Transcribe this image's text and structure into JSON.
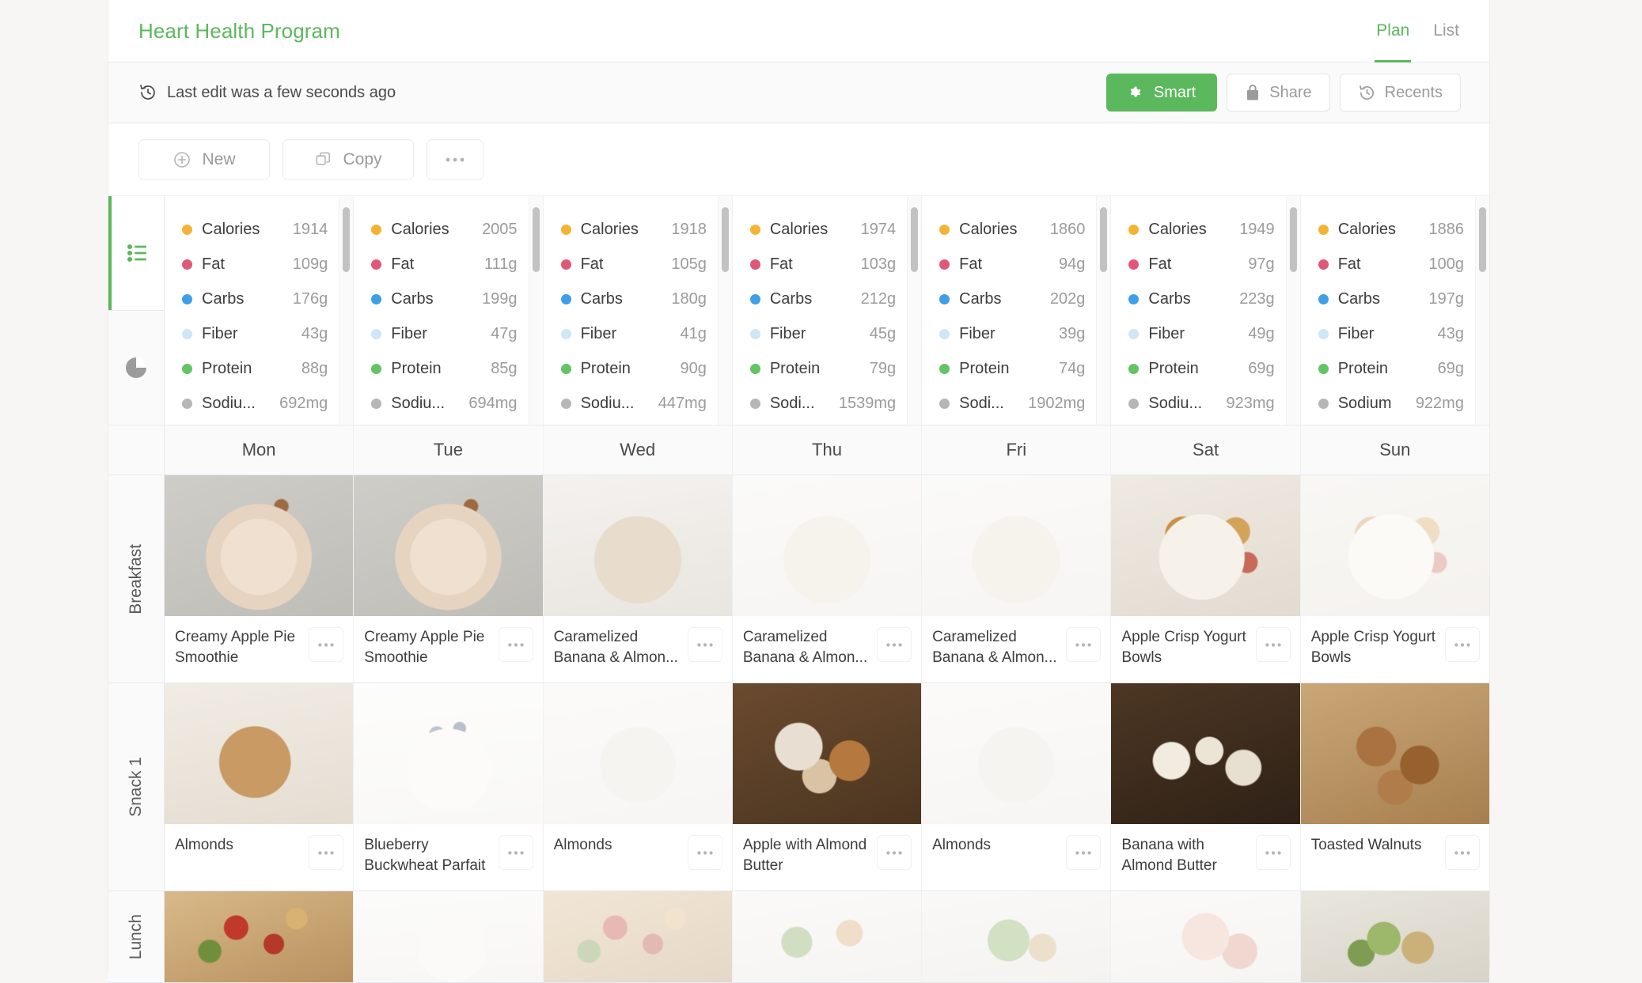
{
  "header": {
    "title": "Heart Health Program",
    "tabs": [
      {
        "label": "Plan",
        "active": true
      },
      {
        "label": "List",
        "active": false
      }
    ]
  },
  "subheader": {
    "last_edit": "Last edit was a few seconds ago",
    "last_edit_icon": "history-icon",
    "buttons": [
      {
        "label": "Smart",
        "icon": "gear-icon",
        "style": "primary",
        "color": "#5cb85c"
      },
      {
        "label": "Share",
        "icon": "lock-icon",
        "style": "default"
      },
      {
        "label": "Recents",
        "icon": "history-icon",
        "style": "default"
      }
    ]
  },
  "toolbar": {
    "buttons": [
      {
        "label": "New",
        "icon": "plus-circle-icon"
      },
      {
        "label": "Copy",
        "icon": "copy-icon"
      },
      {
        "label": "",
        "icon": "ellipsis-icon"
      }
    ]
  },
  "rail": {
    "items": [
      {
        "name": "list-view",
        "icon": "list-icon",
        "active": true,
        "color": "#5cb85c"
      },
      {
        "name": "chart-view",
        "icon": "pie-chart-icon",
        "active": false,
        "color": "#9b9b9b"
      }
    ]
  },
  "nutrition": {
    "labels": [
      "Calories",
      "Fat",
      "Carbs",
      "Fiber",
      "Protein",
      "Sodium"
    ],
    "colors": {
      "Calories": "#f5b335",
      "Fat": "#e05878",
      "Carbs": "#3d9fe8",
      "Fiber": "#cfe6f7",
      "Protein": "#63c463",
      "Sodium": "#b6b6b6"
    },
    "columns": [
      {
        "day": "Mon",
        "sodium_label": "Sodiu...",
        "rows": [
          {
            "label": "Calories",
            "value": "1914"
          },
          {
            "label": "Fat",
            "value": "109g"
          },
          {
            "label": "Carbs",
            "value": "176g"
          },
          {
            "label": "Fiber",
            "value": "43g"
          },
          {
            "label": "Protein",
            "value": "88g"
          },
          {
            "label": "Sodiu...",
            "value": "692mg"
          }
        ]
      },
      {
        "day": "Tue",
        "sodium_label": "Sodiu...",
        "rows": [
          {
            "label": "Calories",
            "value": "2005"
          },
          {
            "label": "Fat",
            "value": "111g"
          },
          {
            "label": "Carbs",
            "value": "199g"
          },
          {
            "label": "Fiber",
            "value": "47g"
          },
          {
            "label": "Protein",
            "value": "85g"
          },
          {
            "label": "Sodiu...",
            "value": "694mg"
          }
        ]
      },
      {
        "day": "Wed",
        "sodium_label": "Sodiu...",
        "rows": [
          {
            "label": "Calories",
            "value": "1918"
          },
          {
            "label": "Fat",
            "value": "105g"
          },
          {
            "label": "Carbs",
            "value": "180g"
          },
          {
            "label": "Fiber",
            "value": "41g"
          },
          {
            "label": "Protein",
            "value": "90g"
          },
          {
            "label": "Sodiu...",
            "value": "447mg"
          }
        ]
      },
      {
        "day": "Thu",
        "sodium_label": "Sodi...",
        "rows": [
          {
            "label": "Calories",
            "value": "1974"
          },
          {
            "label": "Fat",
            "value": "103g"
          },
          {
            "label": "Carbs",
            "value": "212g"
          },
          {
            "label": "Fiber",
            "value": "45g"
          },
          {
            "label": "Protein",
            "value": "79g"
          },
          {
            "label": "Sodi...",
            "value": "1539mg"
          }
        ]
      },
      {
        "day": "Fri",
        "sodium_label": "Sodi...",
        "rows": [
          {
            "label": "Calories",
            "value": "1860"
          },
          {
            "label": "Fat",
            "value": "94g"
          },
          {
            "label": "Carbs",
            "value": "202g"
          },
          {
            "label": "Fiber",
            "value": "39g"
          },
          {
            "label": "Protein",
            "value": "74g"
          },
          {
            "label": "Sodi...",
            "value": "1902mg"
          }
        ]
      },
      {
        "day": "Sat",
        "sodium_label": "Sodiu...",
        "rows": [
          {
            "label": "Calories",
            "value": "1949"
          },
          {
            "label": "Fat",
            "value": "97g"
          },
          {
            "label": "Carbs",
            "value": "223g"
          },
          {
            "label": "Fiber",
            "value": "49g"
          },
          {
            "label": "Protein",
            "value": "69g"
          },
          {
            "label": "Sodiu...",
            "value": "923mg"
          }
        ]
      },
      {
        "day": "Sun",
        "sodium_label": "Sodium",
        "rows": [
          {
            "label": "Calories",
            "value": "1886"
          },
          {
            "label": "Fat",
            "value": "100g"
          },
          {
            "label": "Carbs",
            "value": "197g"
          },
          {
            "label": "Fiber",
            "value": "43g"
          },
          {
            "label": "Protein",
            "value": "69g"
          },
          {
            "label": "Sodium",
            "value": "922mg"
          }
        ]
      }
    ]
  },
  "days": [
    "Mon",
    "Tue",
    "Wed",
    "Thu",
    "Fri",
    "Sat",
    "Sun"
  ],
  "meals": [
    {
      "label": "Breakfast",
      "cells": [
        {
          "title": "Creamy Apple Pie Smoothie",
          "image": "smoothie-cinnamon",
          "faded": false
        },
        {
          "title": "Creamy Apple Pie Smoothie",
          "image": "smoothie-cinnamon",
          "faded": false
        },
        {
          "title": "Caramelized Banana & Almon...",
          "image": "oat-bowl-nutbutter",
          "faded": false
        },
        {
          "title": "Caramelized Banana & Almon...",
          "image": "oat-bowl-nutbutter",
          "faded": true
        },
        {
          "title": "Caramelized Banana & Almon...",
          "image": "oat-bowl-nutbutter",
          "faded": true
        },
        {
          "title": "Apple Crisp Yogurt Bowls",
          "image": "yogurt-granola-apple",
          "faded": false
        },
        {
          "title": "Apple Crisp Yogurt Bowls",
          "image": "yogurt-granola-apple",
          "faded": true
        }
      ]
    },
    {
      "label": "Snack 1",
      "cells": [
        {
          "title": "Almonds",
          "image": "almonds-jar",
          "faded": false
        },
        {
          "title": "Blueberry Buckwheat Parfait",
          "image": "parfait-blueberry",
          "faded": true
        },
        {
          "title": "Almonds",
          "image": "almonds-bowl",
          "faded": true
        },
        {
          "title": "Apple with Almond Butter",
          "image": "apple-almond-butter",
          "faded": false
        },
        {
          "title": "Almonds",
          "image": "almonds-bowl",
          "faded": true
        },
        {
          "title": "Banana with Almond Butter",
          "image": "banana-bites",
          "faded": false
        },
        {
          "title": "Toasted Walnuts",
          "image": "walnuts",
          "faded": false
        }
      ]
    },
    {
      "label": "Lunch",
      "cells": [
        {
          "title": "",
          "image": "pasta-tomato",
          "faded": false
        },
        {
          "title": "",
          "image": "salmon-salad",
          "faded": true
        },
        {
          "title": "",
          "image": "pasta-tomato",
          "faded": true
        },
        {
          "title": "",
          "image": "broccoli-plate",
          "faded": true
        },
        {
          "title": "",
          "image": "greens-bowl",
          "faded": true
        },
        {
          "title": "",
          "image": "smoothie-plate",
          "faded": true
        },
        {
          "title": "",
          "image": "grain-salad",
          "faded": false
        }
      ]
    }
  ],
  "cell_menu_icon": "ellipsis-icon"
}
